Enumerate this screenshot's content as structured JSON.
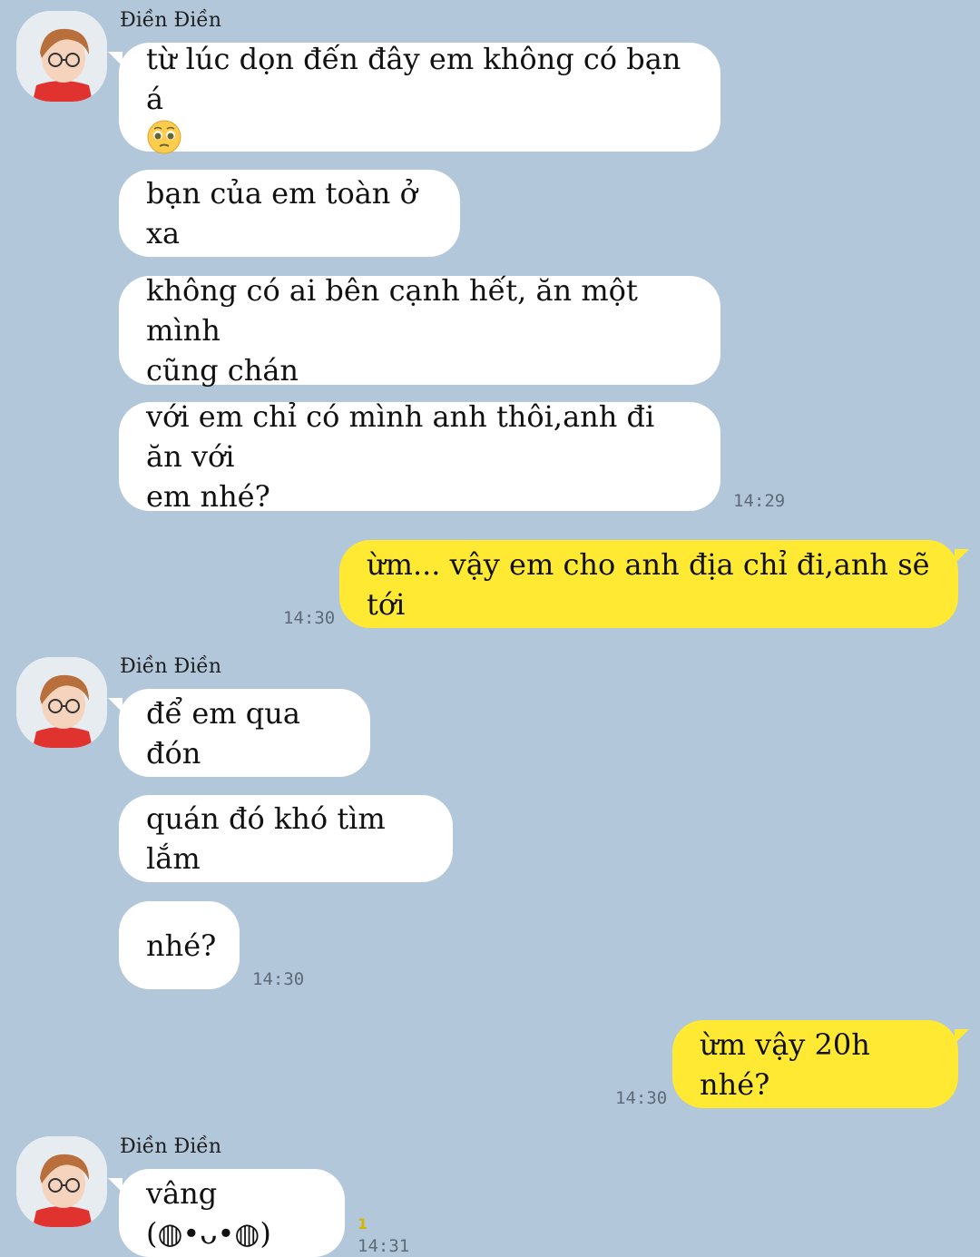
{
  "contact": {
    "name": "Điền Điền"
  },
  "messages": {
    "m1_line1": "từ lúc dọn đến đây em không có bạn á",
    "m1_emoji": "pleading-face-emoji",
    "m2": "bạn của em toàn ở xa",
    "m3_line1": "không có ai bên cạnh hết, ăn một mình",
    "m3_line2": "cũng chán",
    "m4_line1": "với em chỉ có mình anh thôi,anh đi ăn với",
    "m4_line2": "em nhé?",
    "t1": "14:29",
    "o1": "ừm... vậy em cho anh địa chỉ đi,anh sẽ tới",
    "t2": "14:30",
    "m5": "để em qua đón",
    "m6": "quán đó khó tìm lắm",
    "m7": "nhé?",
    "t3": "14:30",
    "o2": "ừm vậy 20h nhé?",
    "t4": "14:30",
    "m8": "vâng (◍•ᴗ•◍)",
    "unread": "1",
    "t5": "14:31"
  },
  "colors": {
    "background": "#b2c7da",
    "incoming": "#ffffff",
    "outgoing": "#ffe933"
  },
  "icons": {
    "avatar": "avatar-photo"
  }
}
